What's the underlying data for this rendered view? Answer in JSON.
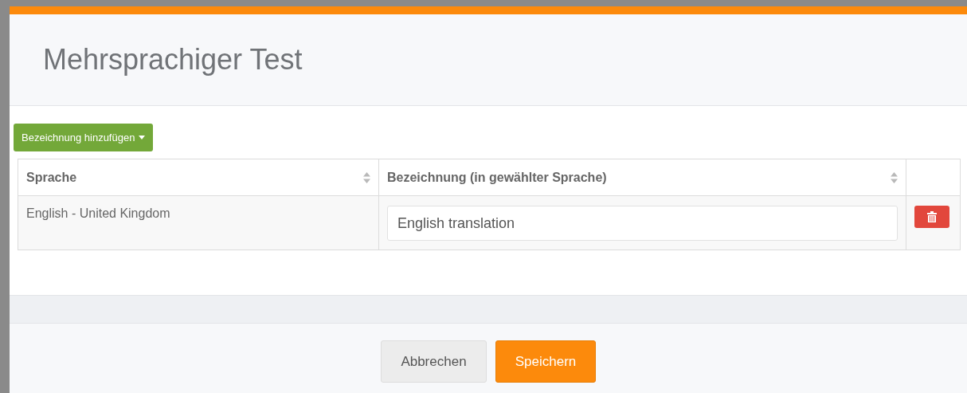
{
  "dialog": {
    "title": "Mehrsprachiger Test"
  },
  "add_button": {
    "label": "Bezeichnung hinzufügen"
  },
  "table": {
    "columns": [
      {
        "label": "Sprache",
        "sortable": true
      },
      {
        "label": "Bezeichnung (in gewählter Sprache)",
        "sortable": true
      },
      {
        "sortable": false
      }
    ],
    "rows": [
      {
        "language": "English - United Kingdom",
        "value": "English translation"
      }
    ]
  },
  "buttons": [
    {
      "label": "Abbrechen",
      "kind": "default"
    },
    {
      "label": "Speichern",
      "kind": "primary"
    }
  ]
}
